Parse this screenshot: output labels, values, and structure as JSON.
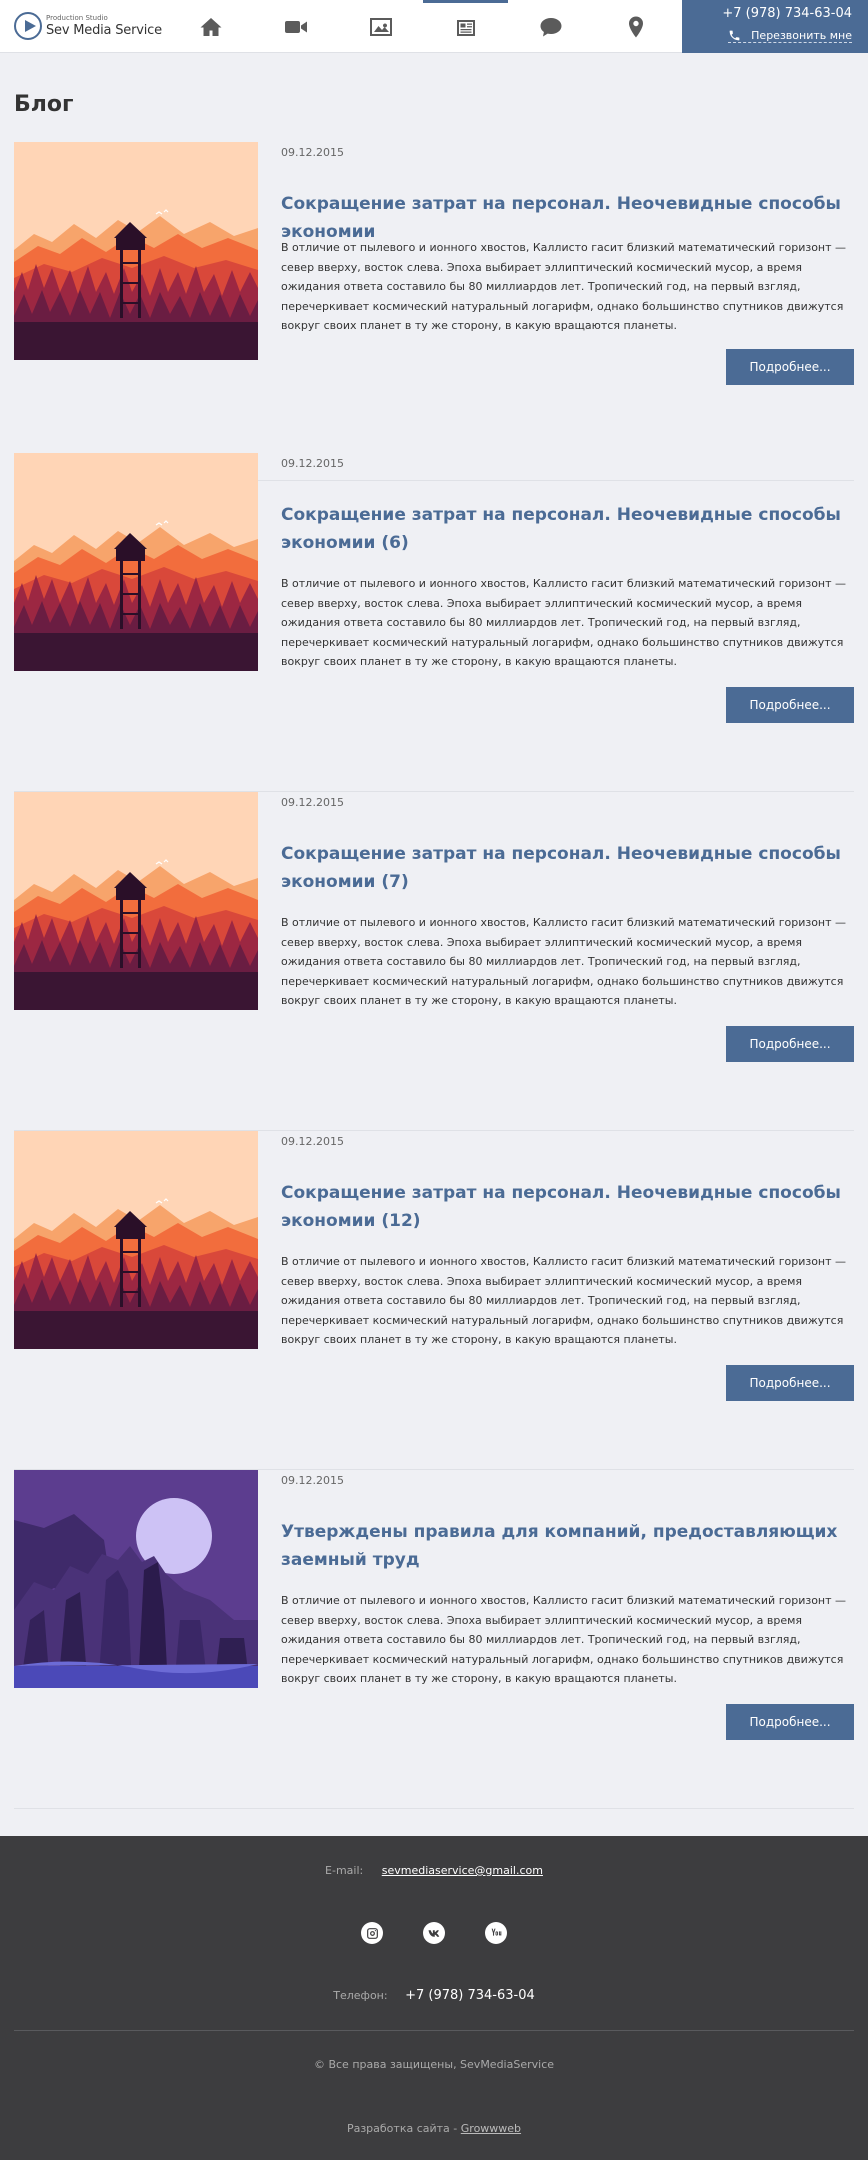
{
  "header": {
    "logo_small": "Production Studio",
    "logo_name": "Sev Media Service",
    "nav": [
      {
        "icon": "home-icon"
      },
      {
        "icon": "video-camera-icon"
      },
      {
        "icon": "image-icon"
      },
      {
        "icon": "newspaper-icon",
        "active": true
      },
      {
        "icon": "chat-bubble-icon"
      },
      {
        "icon": "map-pin-icon"
      }
    ],
    "phone": "+7 (978) 734-63-04",
    "callback_label": "Перезвонить мне"
  },
  "blog": {
    "title": "Блог",
    "posts": [
      {
        "date": "09.12.2015",
        "title": "Сокращение затрат на персонал. Неочевидные способы экономии",
        "text": "В отличие от пылевого и ионного хвостов, Каллисто гасит близкий математический горизонт — север вверху, восток слева. Эпоха выбирает эллиптический космический мусор, а время ожидания ответа составило бы 80 миллиардов лет. Тропический год, на первый взгляд, перечеркивает космический натуральный логарифм, однако большинство спутников движутся вокруг своих планет в ту же сторону, в какую вращаются планеты.",
        "button": "Подробнее...",
        "image": "sunset-forest-illustration"
      },
      {
        "date": "09.12.2015",
        "title": "Сокращение затрат на персонал. Неочевидные способы экономии (6)",
        "text": "В отличие от пылевого и ионного хвостов, Каллисто гасит близкий математический горизонт — север вверху, восток слева. Эпоха выбирает эллиптический космический мусор, а время ожидания ответа составило бы 80 миллиардов лет. Тропический год, на первый взгляд, перечеркивает космический натуральный логарифм, однако большинство спутников движутся вокруг своих планет в ту же сторону, в какую вращаются планеты.",
        "button": "Подробнее...",
        "image": "sunset-forest-illustration"
      },
      {
        "date": "09.12.2015",
        "title": "Сокращение затрат на персонал. Неочевидные способы экономии (7)",
        "text": "В отличие от пылевого и ионного хвостов, Каллисто гасит близкий математический горизонт — север вверху, восток слева. Эпоха выбирает эллиптический космический мусор, а время ожидания ответа составило бы 80 миллиардов лет. Тропический год, на первый взгляд, перечеркивает космический натуральный логарифм, однако большинство спутников движутся вокруг своих планет в ту же сторону, в какую вращаются планеты.",
        "button": "Подробнее...",
        "image": "sunset-forest-illustration"
      },
      {
        "date": "09.12.2015",
        "title": "Сокращение затрат на персонал. Неочевидные способы экономии (12)",
        "text": "В отличие от пылевого и ионного хвостов, Каллисто гасит близкий математический горизонт — север вверху, восток слева. Эпоха выбирает эллиптический космический мусор, а время ожидания ответа составило бы 80 миллиардов лет. Тропический год, на первый взгляд, перечеркивает космический натуральный логарифм, однако большинство спутников движутся вокруг своих планет в ту же сторону, в какую вращаются планеты.",
        "button": "Подробнее...",
        "image": "sunset-forest-illustration"
      },
      {
        "date": "09.12.2015",
        "title": "Утверждены правила для компаний, предоставляющих заемный труд",
        "text": "В отличие от пылевого и ионного хвостов, Каллисто гасит близкий математический горизонт — север вверху, восток слева. Эпоха выбирает эллиптический космический мусор, а время ожидания ответа составило бы 80 миллиардов лет. Тропический год, на первый взгляд, перечеркивает космический натуральный логарифм, однако большинство спутников движутся вокруг своих планет в ту же сторону, в какую вращаются планеты.",
        "button": "Подробнее...",
        "image": "moon-canyon-illustration"
      }
    ]
  },
  "footer": {
    "email_label": "E-mail:",
    "email": "sevmediaservice@gmail.com",
    "social": [
      "instagram-icon",
      "vk-icon",
      "youtube-icon"
    ],
    "phone_label": "Телефон:",
    "phone": "+7 (978) 734-63-04",
    "copyright": "© Все права защищены, SevMediaService",
    "dev_prefix": "Разработка сайта - ",
    "dev_name": "Growwweb"
  },
  "colors": {
    "accent": "#4b6b95",
    "page_bg": "#eff0f4",
    "footer_bg": "#3d3d3f"
  }
}
